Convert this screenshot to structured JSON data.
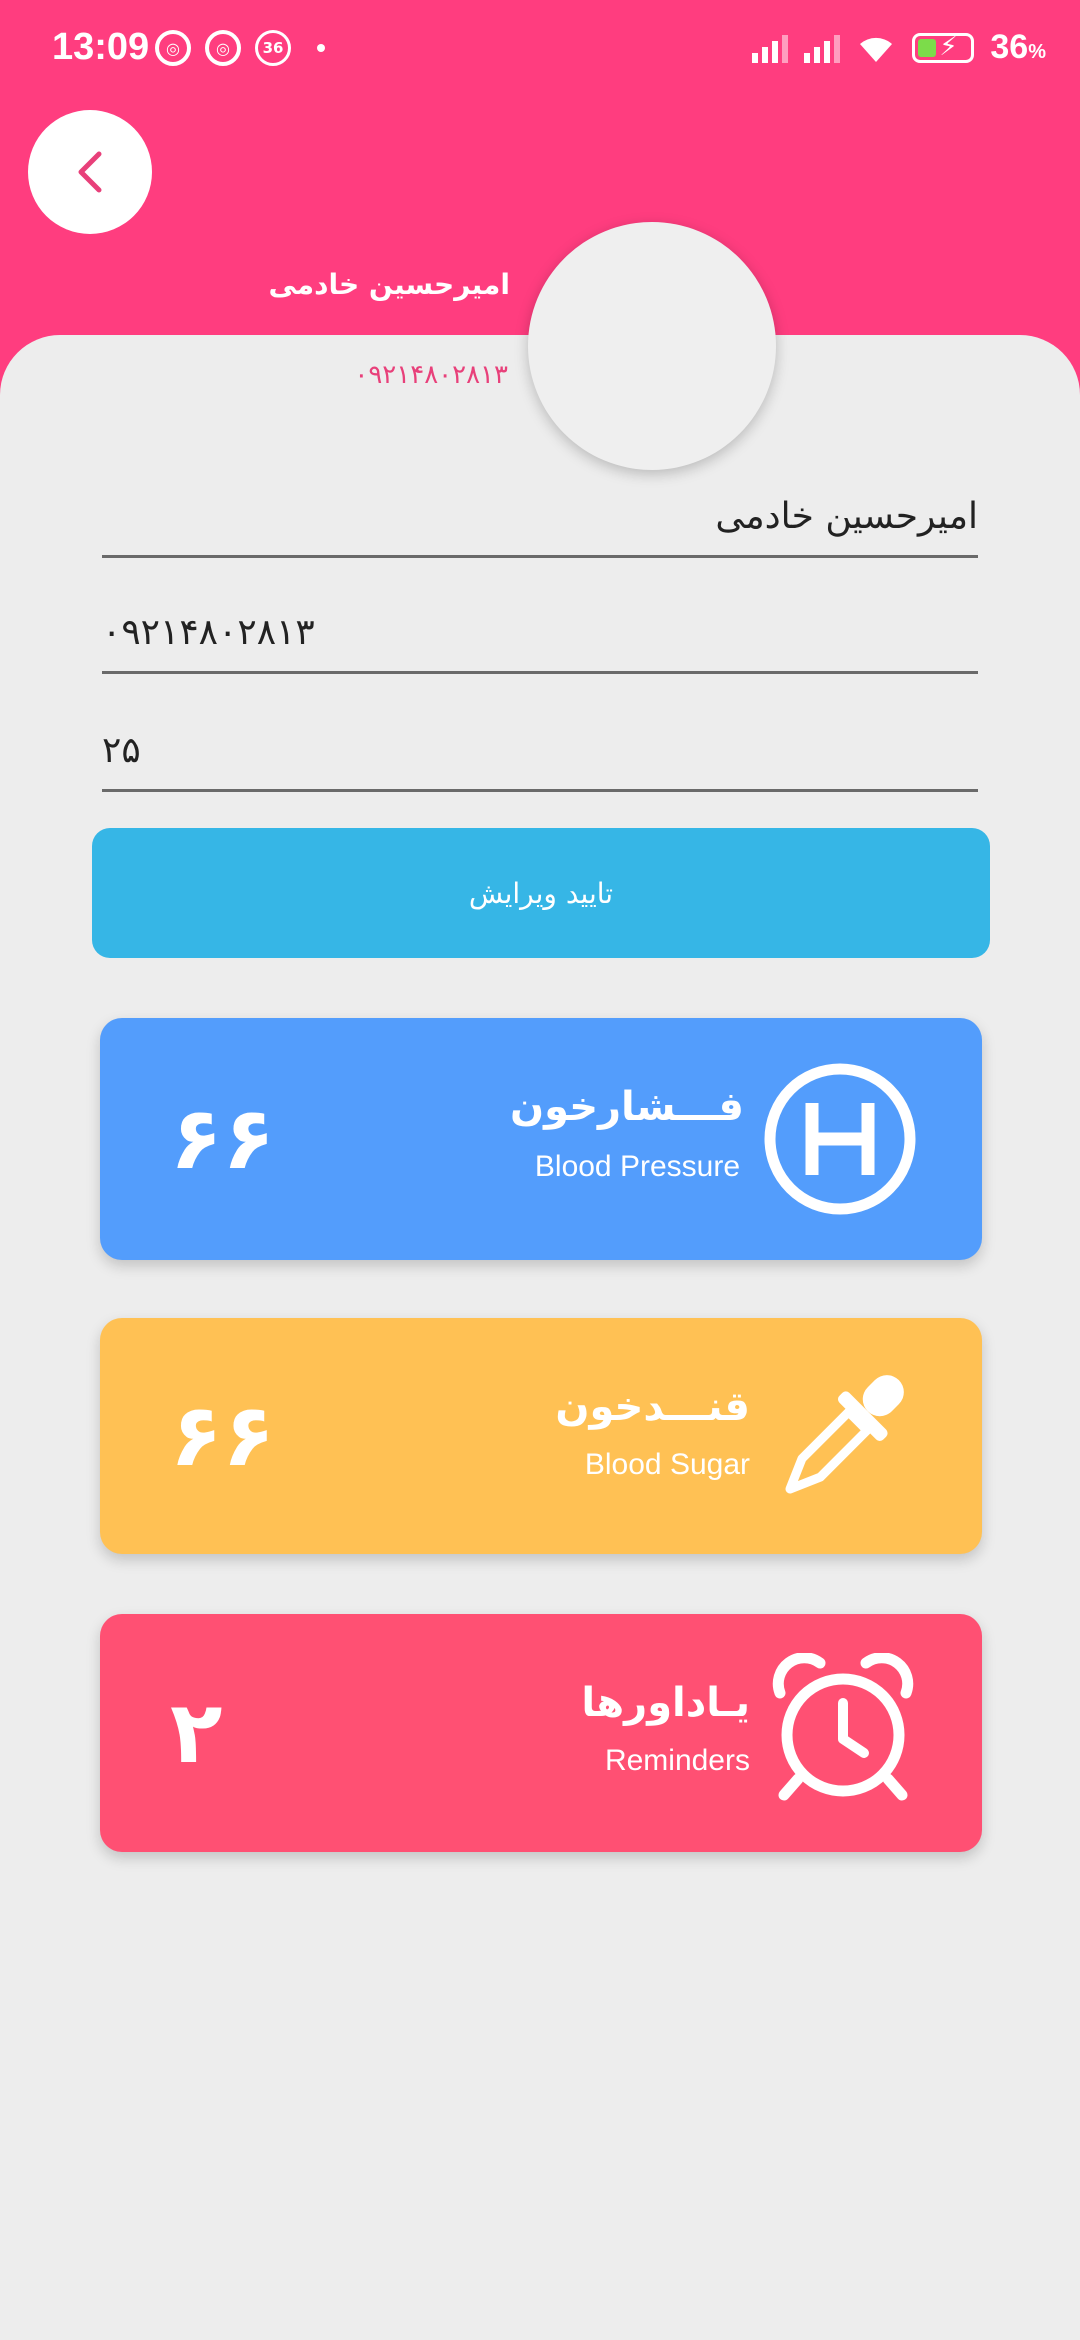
{
  "status_bar": {
    "time": "13:09",
    "notif_badge": "36",
    "battery_text": "36",
    "battery_unit": "%"
  },
  "header": {
    "name": "امیرحسین خادمی",
    "phone": "۰۹۲۱۴۸۰۲۸۱۳"
  },
  "form": {
    "name_value": "امیرحسین خادمی",
    "phone_value": "۰۹۲۱۴۸۰۲۸۱۳",
    "age_value": "۲۵",
    "submit_label": "تایید ویرایش"
  },
  "cards": {
    "blood_pressure": {
      "title_fa": "فـــشارخون",
      "title_en": "Blood Pressure",
      "value": "۶۶",
      "color": "#539dfc"
    },
    "blood_sugar": {
      "title_fa": "قنـــدخون",
      "title_en": "Blood Sugar",
      "value": "۶۶",
      "color": "#ffc154"
    },
    "reminders": {
      "title_fa": "یـاداورها",
      "title_en": "Reminders",
      "value": "۲",
      "color": "#ff5073"
    }
  },
  "colors": {
    "header_bg": "#ff3d7f",
    "page_bg": "#ededed",
    "submit_bg": "#36b6e6"
  }
}
